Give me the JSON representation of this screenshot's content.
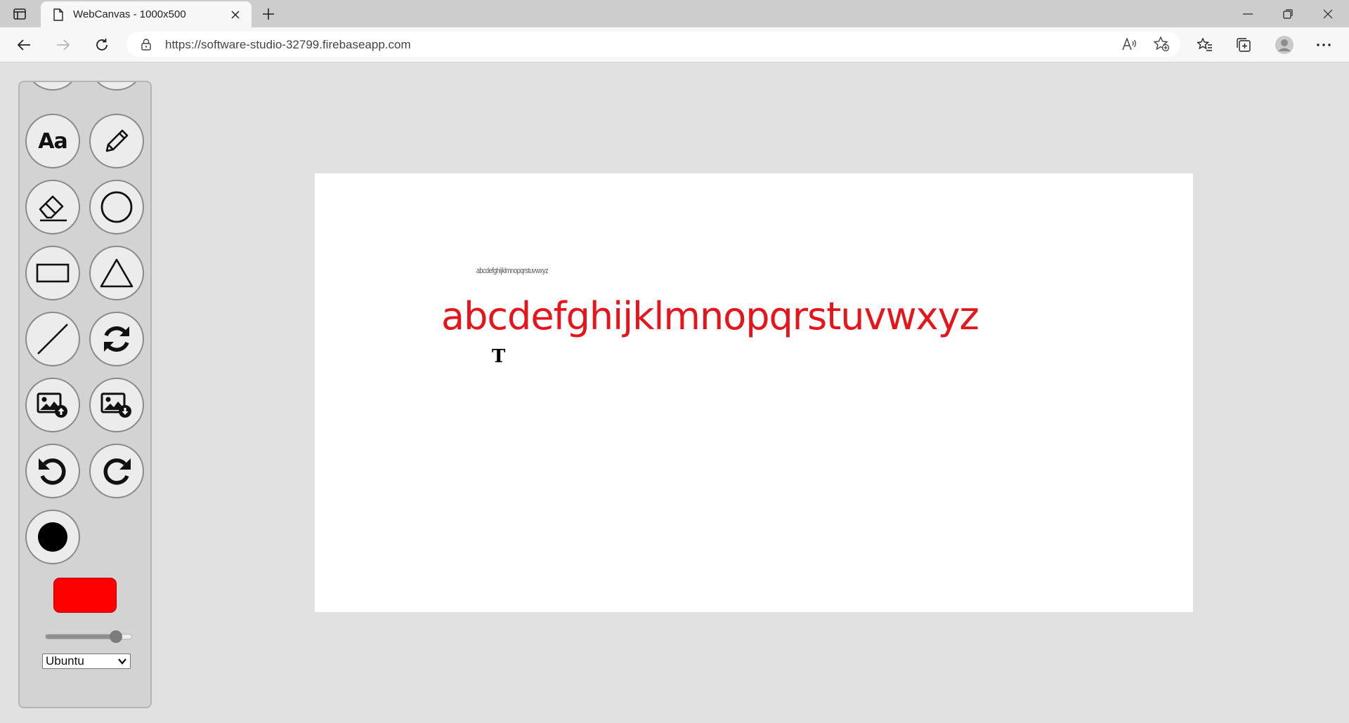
{
  "browser": {
    "tab_title": "WebCanvas - 1000x500",
    "url": "https://software-studio-32799.firebaseapp.com"
  },
  "toolbar": {
    "tools": [
      {
        "name": "text-tool",
        "label": "Aa",
        "icon": "text-icon"
      },
      {
        "name": "pencil-tool",
        "icon": "pencil-icon"
      },
      {
        "name": "eraser-tool",
        "icon": "eraser-icon"
      },
      {
        "name": "circle-tool",
        "icon": "circle-icon"
      },
      {
        "name": "rectangle-tool",
        "icon": "rectangle-icon"
      },
      {
        "name": "triangle-tool",
        "icon": "triangle-icon"
      },
      {
        "name": "line-tool",
        "icon": "line-icon"
      },
      {
        "name": "refresh-tool",
        "icon": "refresh-icon"
      },
      {
        "name": "upload-image-tool",
        "icon": "image-upload-icon"
      },
      {
        "name": "download-image-tool",
        "icon": "image-download-icon"
      },
      {
        "name": "undo-tool",
        "icon": "undo-icon"
      },
      {
        "name": "redo-tool",
        "icon": "redo-icon"
      },
      {
        "name": "brush-size-tool",
        "icon": "filled-circle-icon"
      }
    ],
    "color": "#ff0000",
    "brush_size_fraction": 0.82,
    "font_selected": "Ubuntu"
  },
  "canvas": {
    "small_text": "abcdefghijklmnopqrstuvwxyz",
    "big_text": "abcdefghijklmnopqrstuvwxyz",
    "big_text_color": "#e8141c",
    "cursor_glyph": "T"
  }
}
